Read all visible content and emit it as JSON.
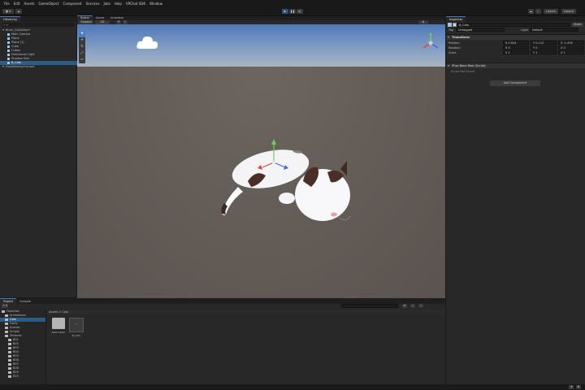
{
  "menu": [
    "File",
    "Edit",
    "Assets",
    "GameObject",
    "Component",
    "Services",
    "Jobs",
    "Help",
    "VRChat SDK",
    "Window"
  ],
  "toolbar": {
    "account_label": "Account",
    "layers_label": "Layers",
    "layout_label": "Layout",
    "cloud_label": "☁"
  },
  "hierarchy": {
    "tab": "Hierarchy",
    "items": [
      {
        "label": "Brain_Collection*",
        "indent": 0,
        "selected": false
      },
      {
        "label": "Main Camera",
        "indent": 2,
        "selected": false
      },
      {
        "label": "Plane",
        "indent": 2,
        "selected": false
      },
      {
        "label": "Plane (1)",
        "indent": 2,
        "selected": false
      },
      {
        "label": "Cube",
        "indent": 2,
        "selected": false
      },
      {
        "label": "Cubes",
        "indent": 2,
        "selected": false
      },
      {
        "label": "Directional Light",
        "indent": 2,
        "selected": false
      },
      {
        "label": "Shadow Test",
        "indent": 2,
        "selected": false
      },
      {
        "label": "B_Cats",
        "indent": 2,
        "selected": true
      },
      {
        "label": "DontDestroyOnLoad",
        "indent": 0,
        "selected": false
      }
    ]
  },
  "scene_tabs": [
    "Scene",
    "Game",
    "Animator"
  ],
  "scene": {
    "shading_mode": "Shaded",
    "dim_mode": "2D"
  },
  "inspector": {
    "tab": "Inspector",
    "object_name": "B_Cats",
    "tag_label": "Tag",
    "tag_value": "Untagged",
    "layer_label": "Layer",
    "layer_value": "Default",
    "transform_header": "Transform",
    "position_label": "Position",
    "rotation_label": "Rotation",
    "scale_label": "Scale",
    "position": [
      "X 0.024",
      "Y 0.112",
      "Z -1.495"
    ],
    "rotation": [
      "X 0",
      "Y 0",
      "Z 0"
    ],
    "scale": [
      "X 1",
      "Y 1",
      "Z 1"
    ],
    "script_header": "Phys Bone Root (Script)",
    "script_sub": "Script Not Found",
    "add_component": "Add Component"
  },
  "project": {
    "tabs": [
      "Project",
      "Console"
    ],
    "breadcrumb": "Assets > Cats",
    "tree": [
      {
        "label": "Favorites",
        "indent": 0
      },
      {
        "label": "Animations",
        "indent": 1
      },
      {
        "label": "Cats",
        "indent": 1,
        "selected": true
      },
      {
        "label": "Fonts",
        "indent": 1
      },
      {
        "label": "Scenes",
        "indent": 1
      },
      {
        "label": "Scripts",
        "indent": 1
      },
      {
        "label": "Textures",
        "indent": 1
      },
      {
        "label": "B01",
        "indent": 2
      },
      {
        "label": "B02",
        "indent": 2
      },
      {
        "label": "B03",
        "indent": 2
      },
      {
        "label": "B04",
        "indent": 2
      },
      {
        "label": "B05",
        "indent": 2
      },
      {
        "label": "B06",
        "indent": 2
      },
      {
        "label": "B07",
        "indent": 2
      },
      {
        "label": "B08",
        "indent": 2
      },
      {
        "label": "B09",
        "indent": 2
      },
      {
        "label": "B10",
        "indent": 2
      }
    ],
    "assets": [
      {
        "label": "New Folder",
        "kind": "folder"
      },
      {
        "label": "B_Cats",
        "kind": "model"
      }
    ]
  },
  "colors": {
    "accent": "#4d7ac6",
    "selection": "#2c5d87",
    "panel": "#282828",
    "background": "#191919"
  }
}
